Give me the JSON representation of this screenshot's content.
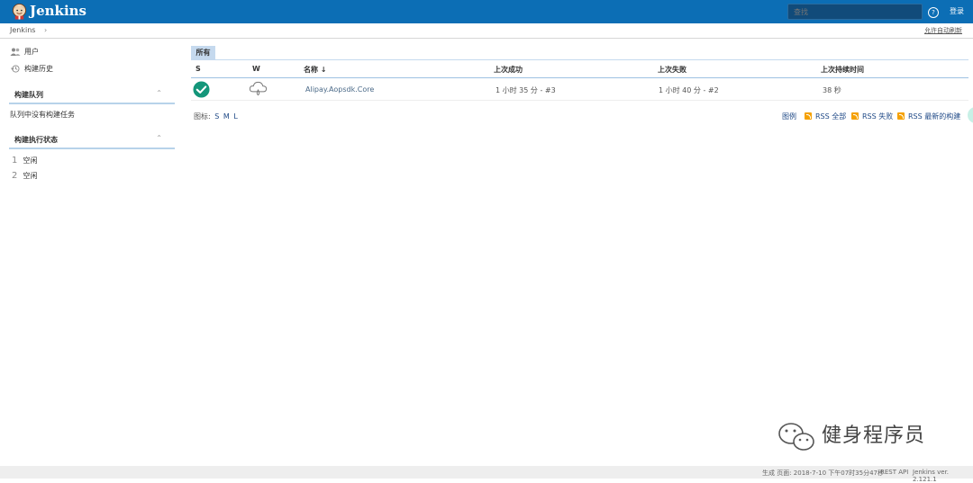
{
  "header": {
    "brand": "Jenkins",
    "search_placeholder": "查找",
    "help": "?",
    "login": "登录"
  },
  "breadcrumb": {
    "root": "Jenkins",
    "separator": "›",
    "autorefresh": "允许自动刷新"
  },
  "sidebar": {
    "links": [
      {
        "label": "用户",
        "icon": "users-icon"
      },
      {
        "label": "构建历史",
        "icon": "history-icon"
      }
    ],
    "queue": {
      "title": "构建队列",
      "empty": "队列中没有构建任务",
      "toggle": "⌃"
    },
    "executors": {
      "title": "构建执行状态",
      "toggle": "⌃",
      "items": [
        {
          "num": "1",
          "state": "空闲"
        },
        {
          "num": "2",
          "state": "空闲"
        }
      ]
    }
  },
  "main": {
    "tab": "所有",
    "columns": {
      "s": "S",
      "w": "W",
      "name": "名称 ↓",
      "last_success": "上次成功",
      "last_failure": "上次失败",
      "last_duration": "上次持续时间"
    },
    "rows": [
      {
        "status_icon": "success-check-icon",
        "weather_icon": "cloud-rain-icon",
        "name": "Alipay.Aopsdk.Core",
        "last_success": "1 小时 35 分 - #3",
        "last_failure": "1 小时 40 分 - #2",
        "last_duration": "38 秒"
      }
    ],
    "icon_size": {
      "label": "图标:",
      "s": "S",
      "m": "M",
      "l": "L"
    },
    "legend": "图例",
    "rss_all": "RSS 全部",
    "rss_failed": "RSS 失败",
    "rss_latest": "RSS 最新的构建"
  },
  "watermark": {
    "text": "健身程序员"
  },
  "footer": {
    "generated": "生成 页面: 2018-7-10 下午07时35分47秒",
    "rest_api": "REST API",
    "version": "Jenkins ver. 2.121.1"
  },
  "colors": {
    "header": "#0c6eb5",
    "success": "#14967a",
    "tab": "#c5d9ee",
    "rss": "#f5a100"
  }
}
